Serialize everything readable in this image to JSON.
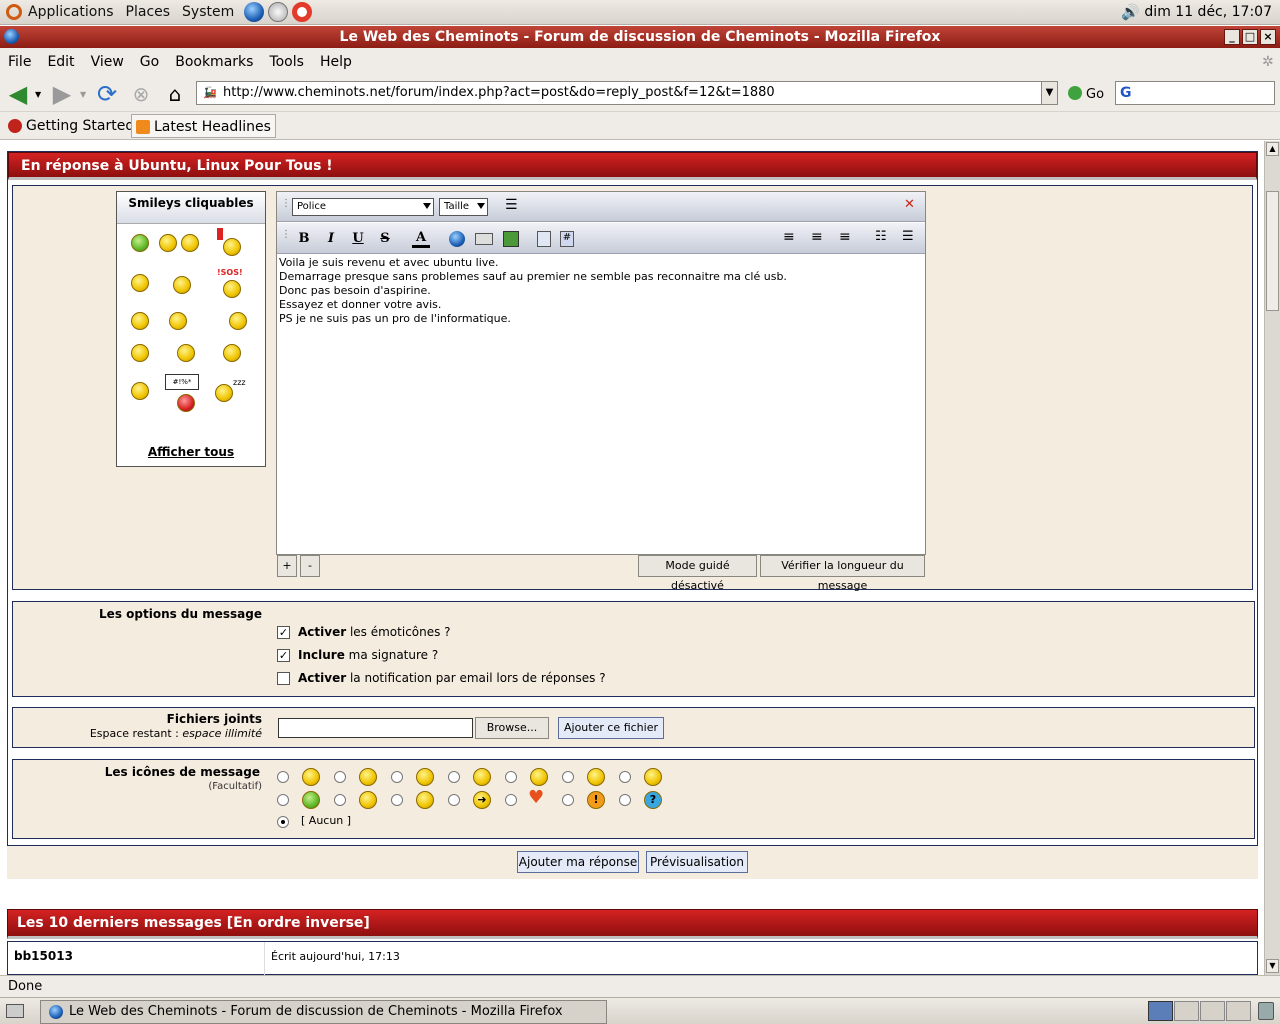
{
  "top_panel": {
    "menus": [
      "Applications",
      "Places",
      "System"
    ],
    "clock": "dim 11 déc, 17:07"
  },
  "window": {
    "title": "Le Web des Cheminots - Forum de discussion de Cheminots - Mozilla Firefox"
  },
  "menubar": [
    "File",
    "Edit",
    "View",
    "Go",
    "Bookmarks",
    "Tools",
    "Help"
  ],
  "navbar": {
    "url": "http://www.cheminots.net/forum/index.php?act=post&do=reply_post&f=12&t=1880",
    "go_label": "Go"
  },
  "bookmarks": [
    "Getting Started",
    "Latest Headlines"
  ],
  "page": {
    "reply_header": "En réponse à Ubuntu, Linux Pour Tous !",
    "smileys": {
      "title": "Smileys cliquables",
      "show_all": "Afficher tous"
    },
    "editor": {
      "font_select": "Police",
      "size_select": "Taille",
      "message_lines": [
        "Voila je suis revenu et avec ubuntu live.",
        "Demarrage presque sans problemes sauf au premier ne semble pas reconnaitre ma clé usb.",
        "Donc pas besoin d'aspirine.",
        "Essayez et donner votre avis.",
        "PS je ne suis pas un pro de l'informatique."
      ],
      "plus": "+",
      "minus": "-",
      "guided_mode": "Mode guidé désactivé",
      "check_length": "Vérifier la longueur du message"
    },
    "options": {
      "title": "Les options du message",
      "items": [
        {
          "bold": "Activer",
          "text": " les émoticônes ?",
          "checked": true
        },
        {
          "bold": "Inclure",
          "text": " ma signature ?",
          "checked": true
        },
        {
          "bold": "Activer",
          "text": " la notification par email lors de réponses ?",
          "checked": false
        }
      ]
    },
    "attachments": {
      "title": "Fichiers joints",
      "space_label": "Espace restant : ",
      "space_value": "espace illimité",
      "browse": "Browse...",
      "add_file": "Ajouter ce fichier"
    },
    "message_icons": {
      "title": "Les icônes de message",
      "optional": "(Facultatif)",
      "none_label": "[ Aucun ]"
    },
    "submit": "Ajouter ma réponse",
    "preview": "Prévisualisation",
    "last_messages_header": "Les 10 derniers messages [En ordre inverse]",
    "last_post": {
      "author": "bb15013",
      "date": "Écrit aujourd'hui, 17:13"
    }
  },
  "statusbar": "Done",
  "taskbar": {
    "task": "Le Web des Cheminots - Forum de discussion de Cheminots - Mozilla Firefox"
  }
}
